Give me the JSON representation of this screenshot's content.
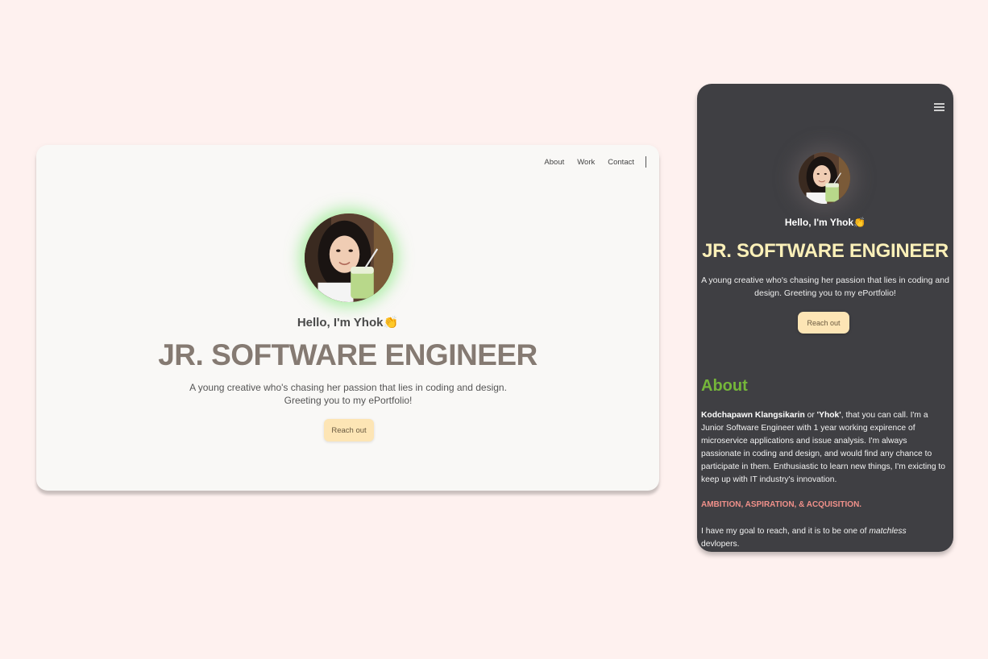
{
  "desktop": {
    "nav": {
      "about": "About",
      "work": "Work",
      "contact": "Contact"
    },
    "hello": "Hello, I'm Yhok👏",
    "title": "JR. SOFTWARE ENGINEER",
    "description_line1": "A young creative who's chasing her passion that lies in coding and design.",
    "description_line2": "Greeting you to my ePortfolio!",
    "cta": "Reach out"
  },
  "mobile": {
    "hello": "Hello, I'm Yhok👏",
    "title": "JR. SOFTWARE ENGINEER",
    "description": "A young creative who's chasing her passion that lies in coding and design. Greeting you to my ePortfolio!",
    "cta": "Reach out",
    "about": {
      "heading": "About",
      "name": "Kodchapawn Klangsikarin",
      "or": " or ",
      "nickname": "'Yhok'",
      "body": ", that you can call. I'm a Junior Software Engineer with 1 year working expirence of microservice applications and issue analysis. I'm always passionate in coding and design, and would find any chance to participate in them. Enthusiastic to learn new things, I'm exicting to keep up with IT industry's innovation.",
      "ambition": "AMBITION, ASPIRATION, & ACQUISITION.",
      "goal_prefix": "I have my goal to reach, and it is to be one of ",
      "goal_emphasis": "matchless",
      "goal_suffix": " devlopers."
    }
  },
  "colors": {
    "page_background": "#fef1ef",
    "desktop_background": "#f9f8f6",
    "mobile_background": "#3f3f43",
    "desktop_title": "#857a72",
    "mobile_title": "#fbf0b8",
    "button": "#fde5b5",
    "about_heading": "#75b63a",
    "ambition": "#f0908a",
    "avatar_glow": "#6ee664"
  },
  "icons": {
    "menu": "hamburger-menu-icon"
  }
}
